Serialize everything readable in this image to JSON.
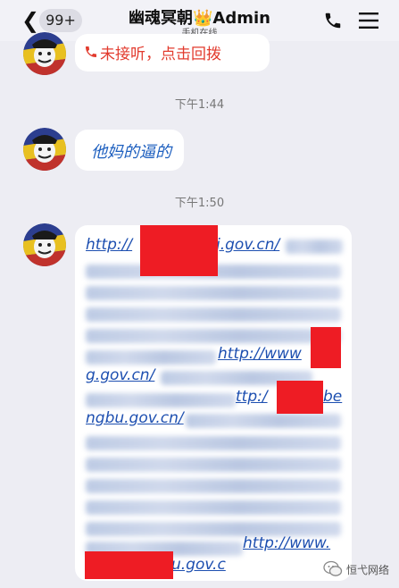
{
  "header": {
    "back_glyph": "❮",
    "unread_count": "99+",
    "title": "幽魂冥朝👑Admin",
    "status": "手机在线"
  },
  "messages": {
    "missed_call": "未接听，点击回拨",
    "time_1": "下午1:44",
    "text_1": "他妈的逼的",
    "time_2": "下午1:50",
    "link_fragments": {
      "line1": "http://",
      "line1b": "j.gov.cn/",
      "line6": "http://www",
      "line7": "g.gov.cn/",
      "line8": "ttp:/",
      "line8b": "be",
      "line9": "ngbu.gov.cn/",
      "line10": "http://www.",
      "line11": "u.gov.c"
    }
  },
  "watermark": {
    "text": "恒弋网络"
  },
  "colors": {
    "accent_link": "#1d4fb0",
    "missed": "#e23b2e",
    "redaction": "#ee1c24"
  }
}
